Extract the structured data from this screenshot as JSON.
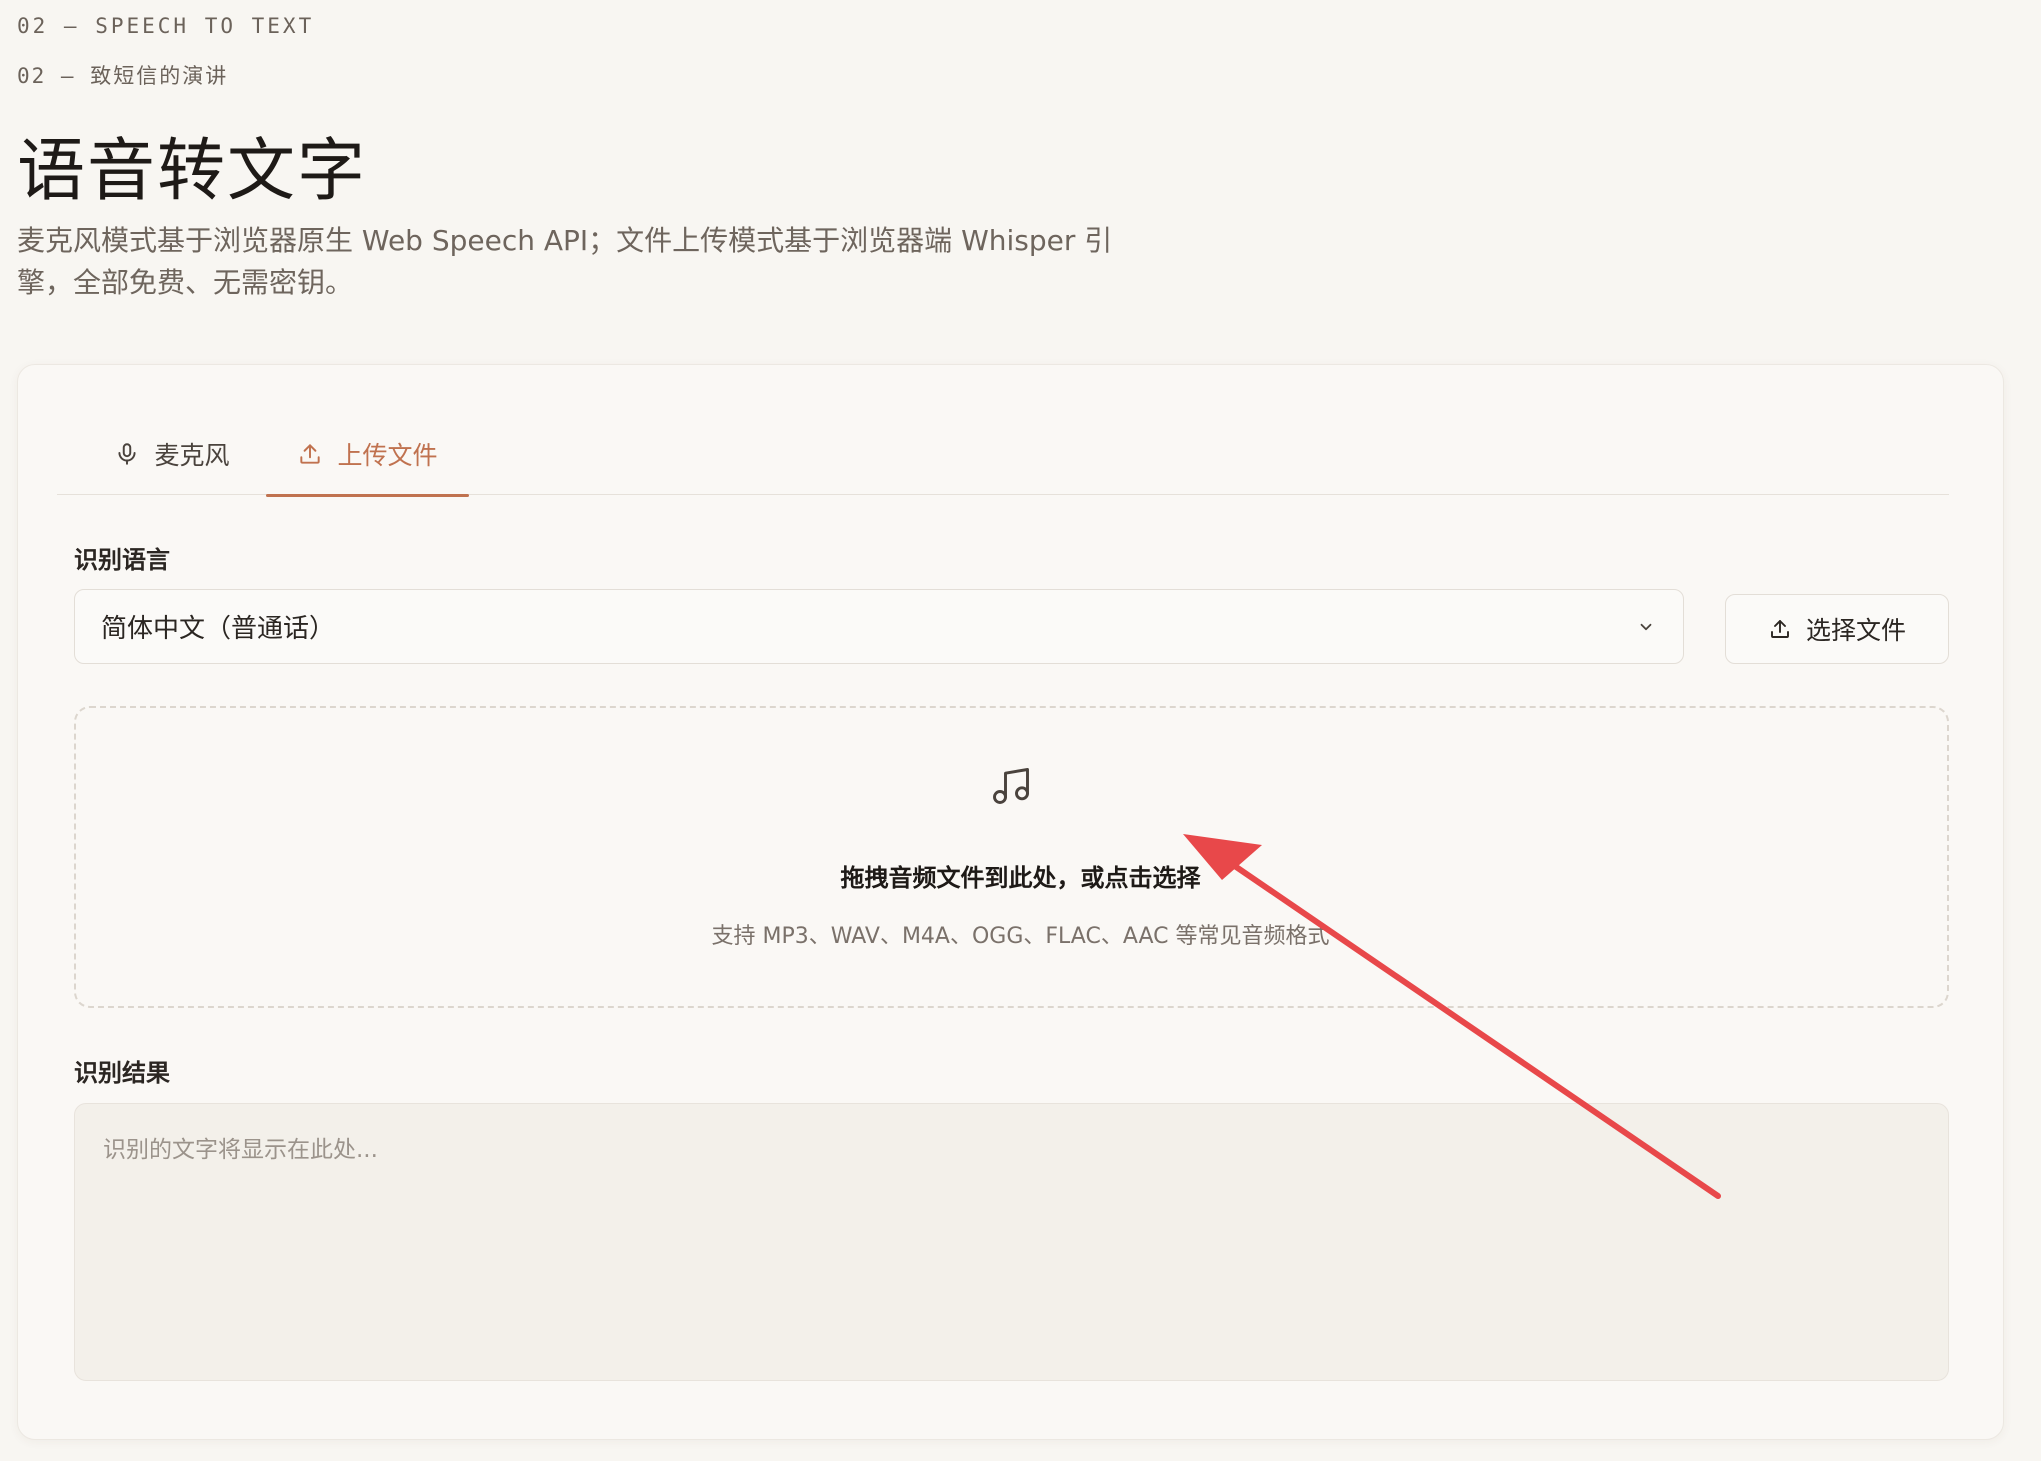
{
  "header": {
    "eyebrow_en": "02 — SPEECH TO TEXT",
    "eyebrow_zh": "02 — 致短信的演讲",
    "title": "语音转文字",
    "description": "麦克风模式基于浏览器原生 Web Speech API；文件上传模式基于浏览器端 Whisper 引擎，全部免费、无需密钥。"
  },
  "tabs": [
    {
      "label": "麦克风",
      "icon": "microphone-icon",
      "active": false
    },
    {
      "label": "上传文件",
      "icon": "upload-icon",
      "active": true
    }
  ],
  "language": {
    "label": "识别语言",
    "selected": "简体中文（普通话）"
  },
  "upload_button": {
    "label": "选择文件",
    "icon": "upload-icon"
  },
  "dropzone": {
    "icon": "music-note-icon",
    "title": "拖拽音频文件到此处，或点击选择",
    "hint": "支持 MP3、WAV、M4A、OGG、FLAC、AAC 等常见音频格式"
  },
  "result": {
    "label": "识别结果",
    "placeholder": "识别的文字将显示在此处...",
    "value": ""
  },
  "colors": {
    "accent": "#c0724f",
    "background": "#f8f6f2",
    "annotation_arrow": "#e8484a"
  }
}
